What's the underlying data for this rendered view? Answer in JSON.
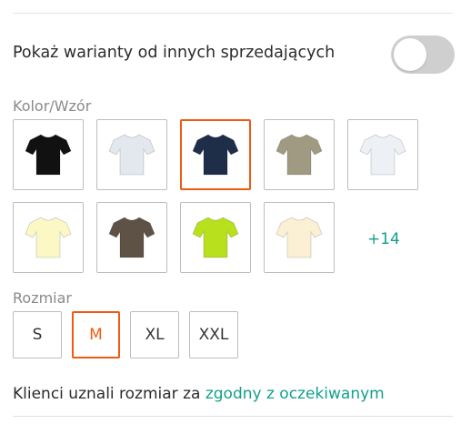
{
  "toggle": {
    "label": "Pokaż warianty od innych sprzedających",
    "state": "off"
  },
  "color": {
    "label": "Kolor/Wzór",
    "selected_index": 2,
    "swatches": [
      {
        "name": "black",
        "color": "#111111"
      },
      {
        "name": "white-grey",
        "color": "#e3e8ee"
      },
      {
        "name": "navy",
        "color": "#1f2e48"
      },
      {
        "name": "khaki",
        "color": "#a09a82"
      },
      {
        "name": "white",
        "color": "#edf0f5"
      },
      {
        "name": "cream",
        "color": "#fbf8c6"
      },
      {
        "name": "brown",
        "color": "#5e5247"
      },
      {
        "name": "lime",
        "color": "#b8e01c"
      },
      {
        "name": "ivory",
        "color": "#fbf0d4"
      }
    ],
    "more_label": "+14"
  },
  "size": {
    "label": "Rozmiar",
    "selected": "M",
    "options": [
      "S",
      "M",
      "XL",
      "XXL"
    ]
  },
  "fit": {
    "prefix": "Klienci uznali rozmiar za ",
    "link": "zgodny z oczekiwanym"
  },
  "colors": {
    "accent": "#f05a12",
    "link": "#13a08c"
  }
}
